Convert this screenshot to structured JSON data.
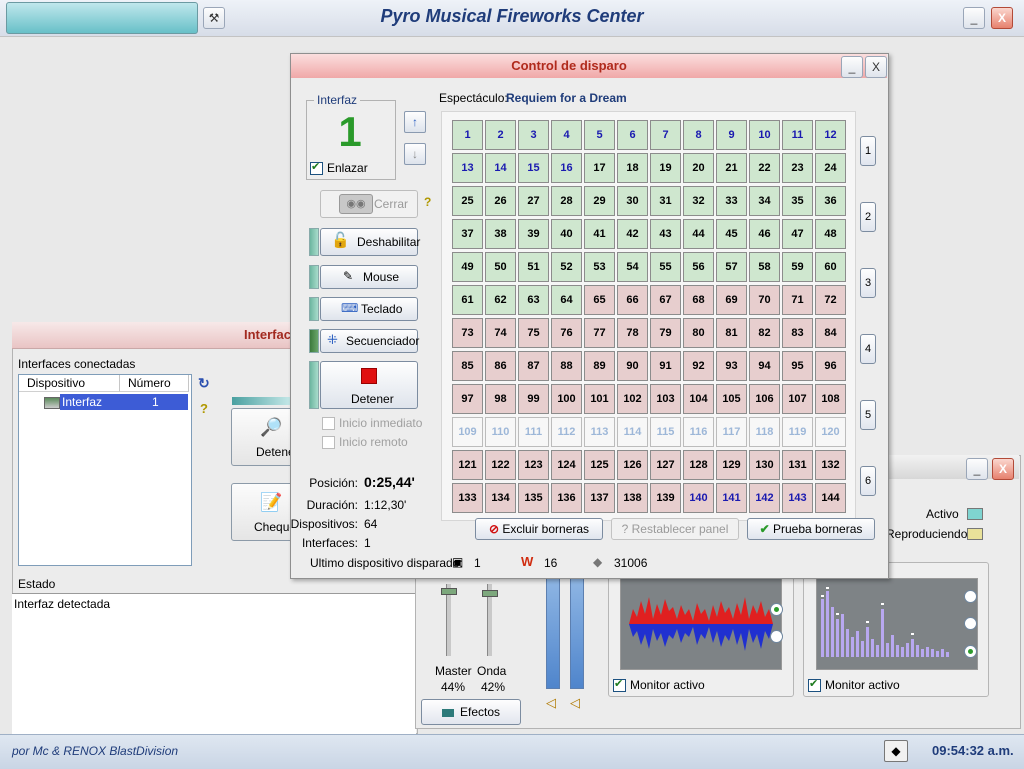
{
  "app": {
    "title": "Pyro Musical Fireworks Center",
    "credit": "por Mc & RENOX BlastDivision",
    "clock": "09:54:32 a.m.",
    "buttons": {
      "minimize": "_",
      "close": "X"
    }
  },
  "interfaces_window": {
    "title": "Interfac",
    "list_label": "Interfaces conectadas",
    "columns": [
      "Dispositivo",
      "Número"
    ],
    "rows": [
      {
        "device": "Interfaz",
        "number": "1"
      }
    ],
    "detener_label": "Detene",
    "chequear_label": "Cheque",
    "estado_label": "Estado",
    "estado_text": "Interfaz detectada"
  },
  "audio_window": {
    "activo_label": "Activo",
    "reproduciendo_label": "Reproduciendo",
    "activo_color": "#7fd4d0",
    "reproduciendo_color": "#e9e29a",
    "master_label": "Master",
    "master_value": "44%",
    "onda_label": "Onda",
    "onda_value": "42%",
    "efectos_label": "Efectos",
    "monitor_label": "Monitor activo"
  },
  "dialog": {
    "title": "Control de disparo",
    "interfaz_legend": "Interfaz",
    "interfaz_number": "1",
    "enlazar_label": "Enlazar",
    "cerrar_label": "Cerrar",
    "deshabilitar_label": "Deshabilitar",
    "mouse_label": "Mouse",
    "teclado_label": "Teclado",
    "secuenciador_label": "Secuenciador",
    "detener_label": "Detener",
    "inicio_inmediato_label": "Inicio inmediato",
    "inicio_remoto_label": "Inicio remoto",
    "espectaculo_label": "Espectáculo:",
    "espectaculo_value": "Requiem for a Dream",
    "posicion_label": "Posición:",
    "posicion_value": "0:25,44'",
    "duracion_label": "Duración:",
    "duracion_value": "1:12,30'",
    "dispositivos_label": "Dispositivos:",
    "dispositivos_value": "64",
    "interfaces_label": "Interfaces:",
    "interfaces_value": "1",
    "ultimo_label": "Ultimo dispositivo disparado:",
    "ultimo_interfaz": "1",
    "ultimo_modulo": "16",
    "ultimo_valor": "31006",
    "excluir_label": "Excluir borneras",
    "restablecer_label": "Restablecer panel",
    "prueba_label": "Prueba borneras",
    "group_labels": [
      "1",
      "2",
      "3",
      "4",
      "5",
      "6"
    ]
  }
}
